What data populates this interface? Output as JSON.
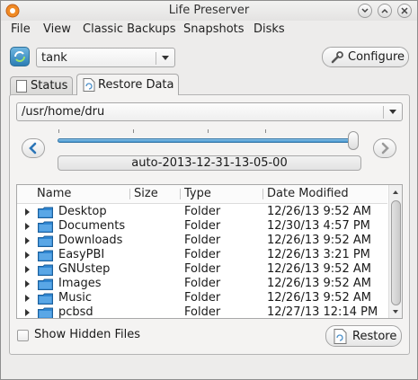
{
  "window": {
    "title": "Life Preserver"
  },
  "menubar": {
    "items": [
      "File",
      "View",
      "Classic Backups",
      "Snapshots",
      "Disks"
    ]
  },
  "pool": {
    "selected": "tank"
  },
  "configure_label": "Configure",
  "tabs": [
    {
      "label": "Status",
      "active": false
    },
    {
      "label": "Restore Data",
      "active": true
    }
  ],
  "restore": {
    "path": "/usr/home/dru",
    "snapshot": "auto-2013-12-31-13-05-00",
    "slider_level": 1.0,
    "columns": [
      "Name",
      "Size",
      "Type",
      "Date Modified"
    ],
    "rows": [
      {
        "name": "Desktop",
        "size": "",
        "type": "Folder",
        "date": "12/26/13 9:52 AM"
      },
      {
        "name": "Documents",
        "size": "",
        "type": "Folder",
        "date": "12/30/13 4:57 PM"
      },
      {
        "name": "Downloads",
        "size": "",
        "type": "Folder",
        "date": "12/26/13 9:52 AM"
      },
      {
        "name": "EasyPBI",
        "size": "",
        "type": "Folder",
        "date": "12/26/13 3:21 PM"
      },
      {
        "name": "GNUstep",
        "size": "",
        "type": "Folder",
        "date": "12/26/13 9:52 AM"
      },
      {
        "name": "Images",
        "size": "",
        "type": "Folder",
        "date": "12/26/13 9:52 AM"
      },
      {
        "name": "Music",
        "size": "",
        "type": "Folder",
        "date": "12/26/13 9:52 AM"
      },
      {
        "name": "pcbsd",
        "size": "",
        "type": "Folder",
        "date": "12/27/13 12:14 PM"
      }
    ],
    "show_hidden_label": "Show Hidden Files",
    "show_hidden_checked": false,
    "restore_label": "Restore"
  },
  "colors": {
    "accent": "#3d8ec9",
    "folder": "#2f86d1"
  }
}
